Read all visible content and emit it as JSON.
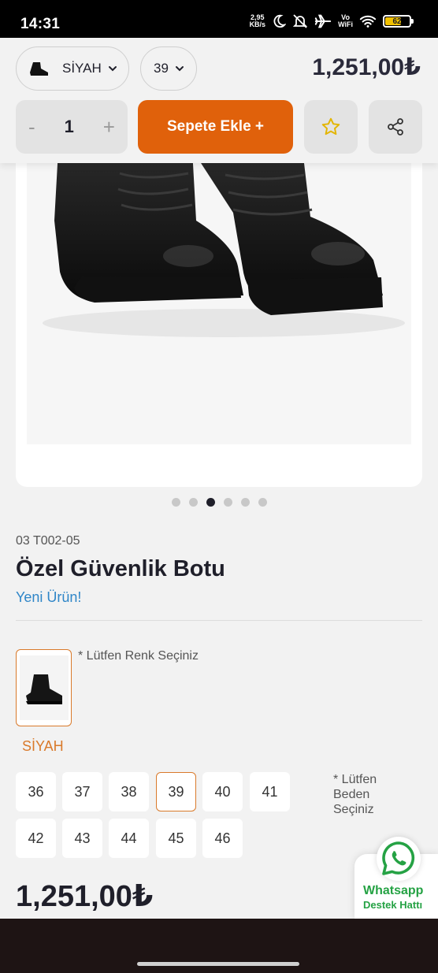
{
  "status_bar": {
    "time": "14:31",
    "net_speed_value": "2,95",
    "net_speed_unit": "KB/s",
    "vowifi_top": "Vo",
    "vowifi_bottom": "WiFi",
    "battery": "62"
  },
  "purchase_bar": {
    "color_select": "SİYAH",
    "size_select": "39",
    "price": "1,251,00₺",
    "qty_minus": "-",
    "qty_value": "1",
    "qty_plus": "+",
    "add_to_cart": "Sepete Ekle +"
  },
  "gallery": {
    "total_images": 6,
    "active_index": 3
  },
  "product": {
    "sku": "03 T002-05",
    "title": "Özel Güvenlik Botu",
    "badge": "Yeni Ürün!",
    "color_prompt": "* Lütfen Renk Seçiniz",
    "selected_color": "SİYAH",
    "size_prompt": "* Lütfen Beden Seçiniz",
    "sizes": [
      "36",
      "37",
      "38",
      "39",
      "40",
      "41",
      "42",
      "43",
      "44",
      "45",
      "46"
    ],
    "selected_size": "39",
    "price": "1,251,00₺"
  },
  "whatsapp": {
    "title": "Whatsapp",
    "subtitle": "Destek Hattı"
  },
  "colors": {
    "accent_orange": "#e0610b",
    "selection_border": "#d97a2b",
    "new_badge_blue": "#2f86c8",
    "whatsapp_green": "#25a244"
  }
}
